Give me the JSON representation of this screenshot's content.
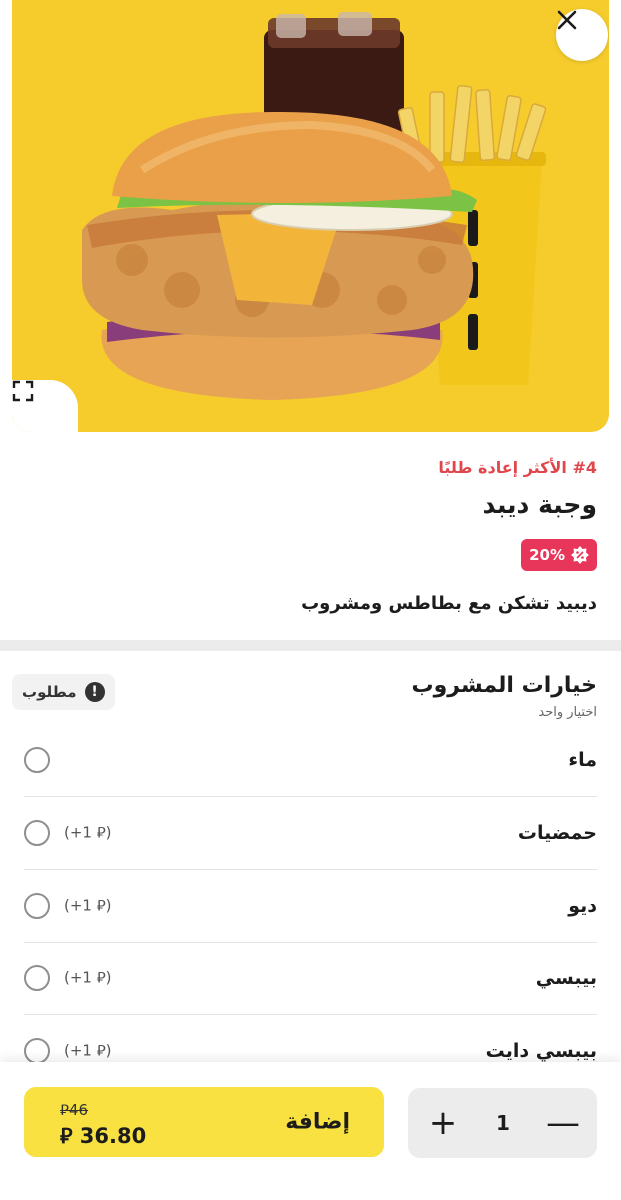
{
  "hero": {
    "close_icon": "close-icon",
    "expand_icon": "expand-icon",
    "image_alt": "burger meal with fries and drink"
  },
  "product": {
    "badge": "#4 الأكثر إعادة طلبًا",
    "title": "وجبة ديبد",
    "discount": "20%",
    "discount_icon": "discount-tag-icon",
    "description": "ديبيد تشكن مع بطاطس ومشروب"
  },
  "options_section": {
    "title": "خيارات المشروب",
    "subtitle": "اختيار واحد",
    "required_label": "مطلوب",
    "required_icon": "!",
    "items": [
      {
        "name": "ماء",
        "price": ""
      },
      {
        "name": "حمضيات",
        "price": "(+1 ⃁)"
      },
      {
        "name": "ديو",
        "price": "(+1 ⃁)"
      },
      {
        "name": "بيبسي",
        "price": "(+1 ⃁)"
      },
      {
        "name": "بيبسي دايت",
        "price": "(+1 ⃁)"
      }
    ]
  },
  "bottom": {
    "quantity": "1",
    "plus": "+",
    "minus": "—",
    "add_label": "إضافة",
    "old_price": "⃁46",
    "new_price": "⃁ 36.80"
  },
  "colors": {
    "hero_bg": "#f6cc2c",
    "accent_red": "#e0474c",
    "discount_bg": "#e8355a",
    "add_button": "#f8e141"
  }
}
